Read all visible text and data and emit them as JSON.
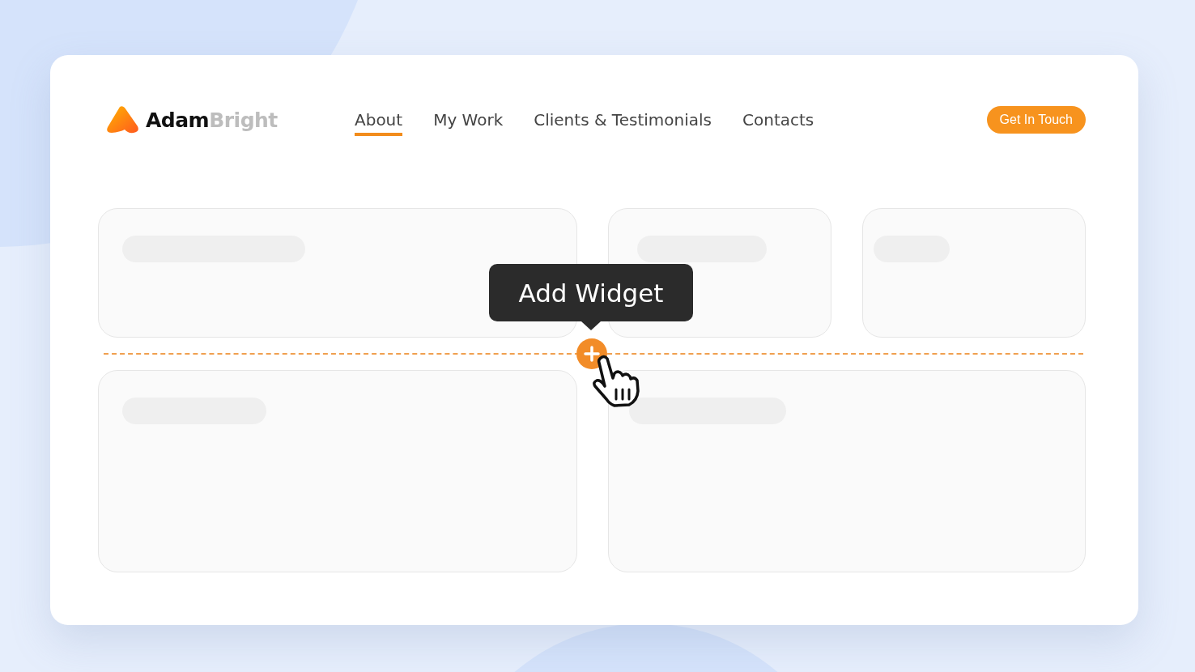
{
  "logo": {
    "primary": "Adam",
    "secondary": "Bright"
  },
  "nav": [
    {
      "label": "About",
      "selected": true
    },
    {
      "label": "My Work",
      "selected": false
    },
    {
      "label": "Clients & Testimonials",
      "selected": false
    },
    {
      "label": "Contacts",
      "selected": false
    }
  ],
  "cta_button": "Get In Touch",
  "tooltip": "Add Widget"
}
